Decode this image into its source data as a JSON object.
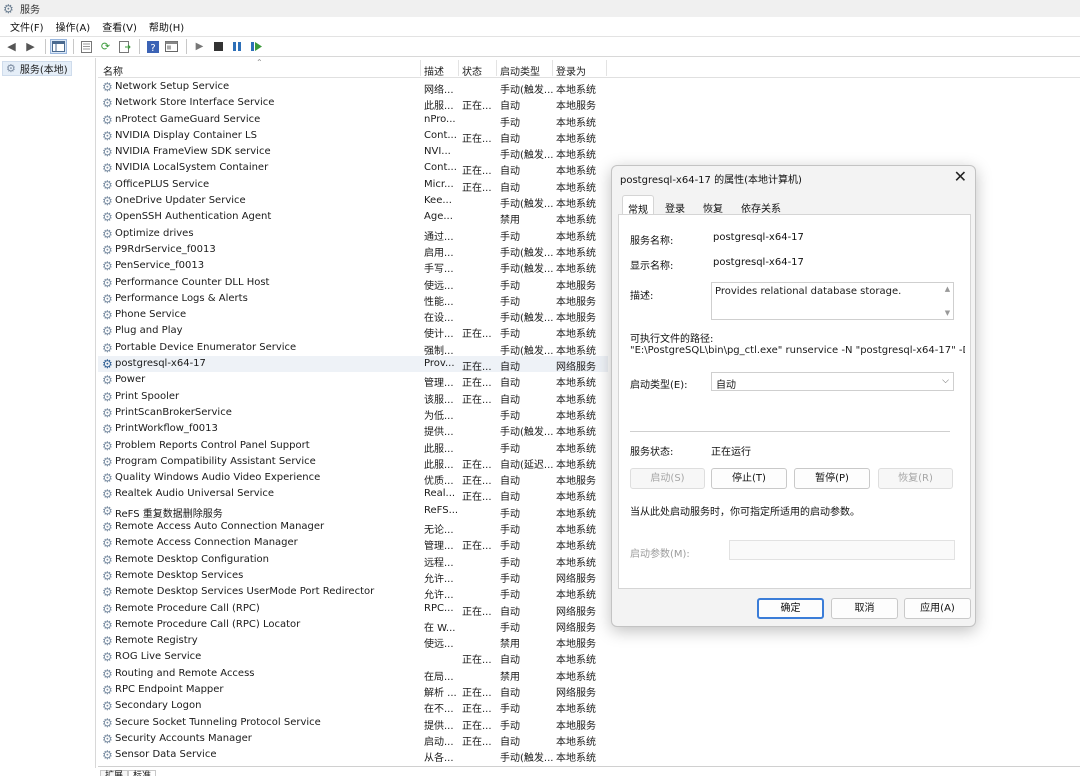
{
  "window": {
    "title": "服务"
  },
  "menu": [
    "文件(F)",
    "操作(A)",
    "查看(V)",
    "帮助(H)"
  ],
  "tree": {
    "root": "服务(本地)"
  },
  "columns": {
    "name": "名称",
    "desc": "描述",
    "status": "状态",
    "startup": "启动类型",
    "logon": "登录为"
  },
  "services": [
    {
      "name": "Network Setup Service",
      "desc": "网络...",
      "status": "",
      "startup": "手动(触发...",
      "logon": "本地系统"
    },
    {
      "name": "Network Store Interface Service",
      "desc": "此服...",
      "status": "正在...",
      "startup": "自动",
      "logon": "本地服务"
    },
    {
      "name": "nProtect GameGuard Service",
      "desc": "nPro...",
      "status": "",
      "startup": "手动",
      "logon": "本地系统"
    },
    {
      "name": "NVIDIA Display Container LS",
      "desc": "Cont...",
      "status": "正在...",
      "startup": "自动",
      "logon": "本地系统"
    },
    {
      "name": "NVIDIA FrameView SDK service",
      "desc": "NVI...",
      "status": "",
      "startup": "手动(触发...",
      "logon": "本地系统"
    },
    {
      "name": "NVIDIA LocalSystem Container",
      "desc": "Cont...",
      "status": "正在...",
      "startup": "自动",
      "logon": "本地系统"
    },
    {
      "name": "OfficePLUS Service",
      "desc": "Micr...",
      "status": "正在...",
      "startup": "自动",
      "logon": "本地系统"
    },
    {
      "name": "OneDrive Updater Service",
      "desc": "Kee...",
      "status": "",
      "startup": "手动(触发...",
      "logon": "本地系统"
    },
    {
      "name": "OpenSSH Authentication Agent",
      "desc": "Age...",
      "status": "",
      "startup": "禁用",
      "logon": "本地系统"
    },
    {
      "name": "Optimize drives",
      "desc": "通过...",
      "status": "",
      "startup": "手动",
      "logon": "本地系统"
    },
    {
      "name": "P9RdrService_f0013",
      "desc": "启用...",
      "status": "",
      "startup": "手动(触发...",
      "logon": "本地系统"
    },
    {
      "name": "PenService_f0013",
      "desc": "手写...",
      "status": "",
      "startup": "手动(触发...",
      "logon": "本地系统"
    },
    {
      "name": "Performance Counter DLL Host",
      "desc": "使远...",
      "status": "",
      "startup": "手动",
      "logon": "本地服务"
    },
    {
      "name": "Performance Logs & Alerts",
      "desc": "性能...",
      "status": "",
      "startup": "手动",
      "logon": "本地服务"
    },
    {
      "name": "Phone Service",
      "desc": "在设...",
      "status": "",
      "startup": "手动(触发...",
      "logon": "本地服务"
    },
    {
      "name": "Plug and Play",
      "desc": "使计...",
      "status": "正在...",
      "startup": "手动",
      "logon": "本地系统"
    },
    {
      "name": "Portable Device Enumerator Service",
      "desc": "强制...",
      "status": "",
      "startup": "手动(触发...",
      "logon": "本地系统"
    },
    {
      "name": "postgresql-x64-17",
      "desc": "Prov...",
      "status": "正在...",
      "startup": "自动",
      "logon": "网络服务",
      "selected": true
    },
    {
      "name": "Power",
      "desc": "管理...",
      "status": "正在...",
      "startup": "自动",
      "logon": "本地系统"
    },
    {
      "name": "Print Spooler",
      "desc": "该服...",
      "status": "正在...",
      "startup": "自动",
      "logon": "本地系统"
    },
    {
      "name": "PrintScanBrokerService",
      "desc": "为低...",
      "status": "",
      "startup": "手动",
      "logon": "本地系统"
    },
    {
      "name": "PrintWorkflow_f0013",
      "desc": "提供...",
      "status": "",
      "startup": "手动(触发...",
      "logon": "本地系统"
    },
    {
      "name": "Problem Reports Control Panel Support",
      "desc": "此服...",
      "status": "",
      "startup": "手动",
      "logon": "本地系统"
    },
    {
      "name": "Program Compatibility Assistant Service",
      "desc": "此服...",
      "status": "正在...",
      "startup": "自动(延迟...",
      "logon": "本地系统"
    },
    {
      "name": "Quality Windows Audio Video Experience",
      "desc": "优质...",
      "status": "正在...",
      "startup": "自动",
      "logon": "本地服务"
    },
    {
      "name": "Realtek Audio Universal Service",
      "desc": "Real...",
      "status": "正在...",
      "startup": "自动",
      "logon": "本地系统"
    },
    {
      "name": "ReFS 重复数据删除服务",
      "desc": "ReFS...",
      "status": "",
      "startup": "手动",
      "logon": "本地系统"
    },
    {
      "name": "Remote Access Auto Connection Manager",
      "desc": "无论...",
      "status": "",
      "startup": "手动",
      "logon": "本地系统"
    },
    {
      "name": "Remote Access Connection Manager",
      "desc": "管理...",
      "status": "正在...",
      "startup": "手动",
      "logon": "本地系统"
    },
    {
      "name": "Remote Desktop Configuration",
      "desc": "远程...",
      "status": "",
      "startup": "手动",
      "logon": "本地系统"
    },
    {
      "name": "Remote Desktop Services",
      "desc": "允许...",
      "status": "",
      "startup": "手动",
      "logon": "网络服务"
    },
    {
      "name": "Remote Desktop Services UserMode Port Redirector",
      "desc": "允许...",
      "status": "",
      "startup": "手动",
      "logon": "本地系统"
    },
    {
      "name": "Remote Procedure Call (RPC)",
      "desc": "RPC...",
      "status": "正在...",
      "startup": "自动",
      "logon": "网络服务"
    },
    {
      "name": "Remote Procedure Call (RPC) Locator",
      "desc": "在 W...",
      "status": "",
      "startup": "手动",
      "logon": "网络服务"
    },
    {
      "name": "Remote Registry",
      "desc": "使远...",
      "status": "",
      "startup": "禁用",
      "logon": "本地服务"
    },
    {
      "name": "ROG Live Service",
      "desc": "",
      "status": "正在...",
      "startup": "自动",
      "logon": "本地系统"
    },
    {
      "name": "Routing and Remote Access",
      "desc": "在局...",
      "status": "",
      "startup": "禁用",
      "logon": "本地系统"
    },
    {
      "name": "RPC Endpoint Mapper",
      "desc": "解析 ...",
      "status": "正在...",
      "startup": "自动",
      "logon": "网络服务"
    },
    {
      "name": "Secondary Logon",
      "desc": "在不...",
      "status": "正在...",
      "startup": "手动",
      "logon": "本地系统"
    },
    {
      "name": "Secure Socket Tunneling Protocol Service",
      "desc": "提供...",
      "status": "正在...",
      "startup": "手动",
      "logon": "本地服务"
    },
    {
      "name": "Security Accounts Manager",
      "desc": "启动...",
      "status": "正在...",
      "startup": "自动",
      "logon": "本地系统"
    },
    {
      "name": "Sensor Data Service",
      "desc": "从各...",
      "status": "",
      "startup": "手动(触发...",
      "logon": "本地系统"
    }
  ],
  "bottom_tabs": [
    "扩展",
    "标准"
  ],
  "dialog": {
    "title": "postgresql-x64-17 的属性(本地计算机)",
    "close": "✕",
    "tabs": [
      "常规",
      "登录",
      "恢复",
      "依存关系"
    ],
    "service_name_label": "服务名称:",
    "service_name": "postgresql-x64-17",
    "display_name_label": "显示名称:",
    "display_name": "postgresql-x64-17",
    "description_label": "描述:",
    "description": "Provides relational database storage.",
    "path_label": "可执行文件的路径:",
    "path": "\"E:\\PostgreSQL\\bin\\pg_ctl.exe\" runservice -N \"postgresql-x64-17\" -D \"D",
    "startup_type_label": "启动类型(E):",
    "startup_type": "自动",
    "service_status_label": "服务状态:",
    "service_status": "正在运行",
    "start_btn": "启动(S)",
    "stop_btn": "停止(T)",
    "pause_btn": "暂停(P)",
    "resume_btn": "恢复(R)",
    "hint": "当从此处启动服务时，你可指定所适用的启动参数。",
    "param_label": "启动参数(M):",
    "ok_btn": "确定",
    "cancel_btn": "取消",
    "apply_btn": "应用(A)"
  }
}
